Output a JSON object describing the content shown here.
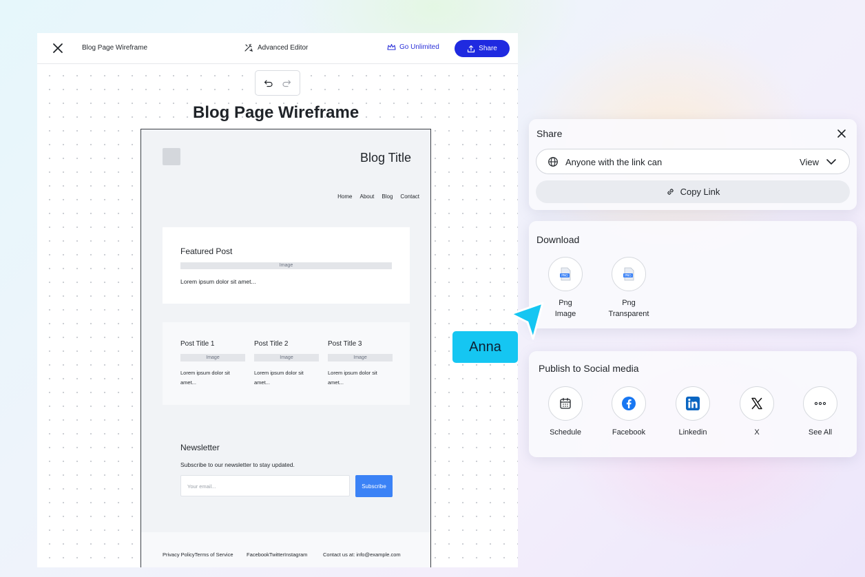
{
  "editor": {
    "doc_name": "Blog Page Wireframe",
    "advanced_editor": "Advanced Editor",
    "go_unlimited": "Go Unlimited",
    "share_label": "Share",
    "canvas_title": "Blog Page Wireframe"
  },
  "wireframe": {
    "blog_title": "Blog Title",
    "nav": [
      "Home",
      "About",
      "Blog",
      "Contact"
    ],
    "featured": {
      "title": "Featured Post",
      "image_label": "Image",
      "desc": "Lorem ipsum dolor sit amet..."
    },
    "posts": [
      {
        "title": "Post Title 1",
        "image_label": "Image",
        "desc": "Lorem ipsum dolor sit amet..."
      },
      {
        "title": "Post Title 2",
        "image_label": "Image",
        "desc": "Lorem ipsum dolor sit amet..."
      },
      {
        "title": "Post Title 3",
        "image_label": "Image",
        "desc": "Lorem ipsum dolor sit amet..."
      }
    ],
    "newsletter": {
      "title": "Newsletter",
      "subtitle": "Subscribe to our newsletter to stay updated.",
      "placeholder": "Your email...",
      "button": "Subscribe"
    },
    "footer": {
      "links_left": "Privacy PolicyTerms of Service",
      "social": "FacebookTwitterInstagram",
      "contact": "Contact us at: info@example.com"
    }
  },
  "share_panel": {
    "title": "Share",
    "access_label": "Anyone with the link can",
    "access_value": "View",
    "copy_link": "Copy Link"
  },
  "download_panel": {
    "title": "Download",
    "items": [
      {
        "label_line1": "Png",
        "label_line2": "Image",
        "icon": "png-file-icon",
        "badge": "PNG"
      },
      {
        "label_line1": "Png",
        "label_line2": "Transparent",
        "icon": "png-file-icon",
        "badge": "PNG"
      }
    ]
  },
  "social_panel": {
    "title": "Publish to Social media",
    "items": [
      {
        "label": "Schedule",
        "icon": "calendar-icon"
      },
      {
        "label": "Facebook",
        "icon": "facebook-icon"
      },
      {
        "label": "Linkedin",
        "icon": "linkedin-icon"
      },
      {
        "label": "X",
        "icon": "x-icon"
      },
      {
        "label": "See All",
        "icon": "more-icon"
      }
    ]
  },
  "collaborator": {
    "name": "Anna",
    "color": "#15c6f2"
  },
  "colors": {
    "accent": "#1f2ae0",
    "subscribe": "#3b82f6",
    "facebook": "#1877f2",
    "linkedin": "#0a66c2"
  }
}
